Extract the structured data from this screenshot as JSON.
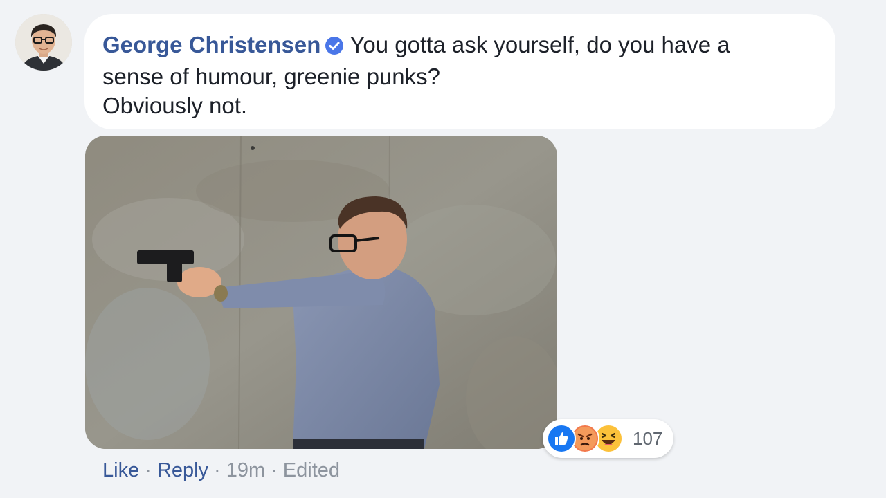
{
  "comment": {
    "author": "George Christensen",
    "text_line1": "You gotta ask yourself, do you have a",
    "text_line2": "sense of humour, greenie punks?",
    "text_line3": "Obviously not."
  },
  "reactions": {
    "icons": [
      "like-icon",
      "angry-icon",
      "haha-icon"
    ],
    "count": "107"
  },
  "actions": {
    "like": "Like",
    "reply": "Reply",
    "separator": "·",
    "time": "19m",
    "edited": "Edited"
  },
  "colors": {
    "author": "#385898",
    "link": "#385898",
    "muted": "#8d949e",
    "like_blue": "#1877f2",
    "angry_orange": "#f2784b",
    "haha_yellow": "#fcc13a",
    "background": "#f1f3f6"
  }
}
